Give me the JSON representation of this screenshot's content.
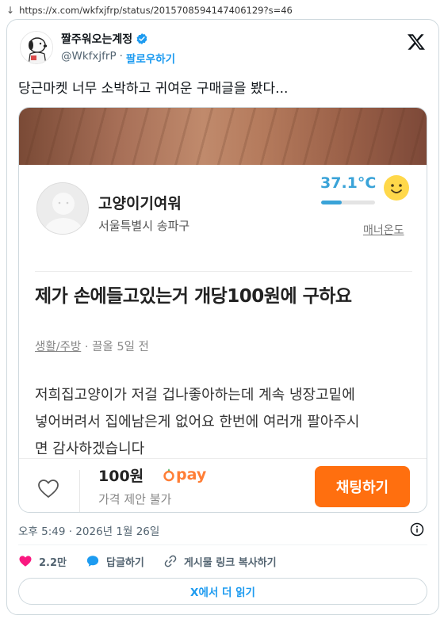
{
  "browser": {
    "url": "https://x.com/wkfxjfrp/status/2015708594147406129?s=46"
  },
  "tweet": {
    "display_name": "짤주워오는계정",
    "handle": "@WkfxjfrP",
    "follow_label": "팔로우하기",
    "text": "당근마켓 너무 소박하고 귀여운 구매글을 봤다...",
    "timestamp": "오후 5:49 · 2026년 1월 26일",
    "likes_count": "2.2만",
    "reply_label": "답글하기",
    "copy_link_label": "게시물 링크 복사하기",
    "read_more_label": "X에서 더 읽기",
    "icons": {
      "verified": "verified-badge-icon",
      "logo": "x-logo-icon",
      "like": "heart-icon",
      "reply": "speech-bubble-icon",
      "link": "link-icon",
      "info": "info-icon"
    },
    "colors": {
      "accent": "#1d9bf0",
      "like": "#f91880"
    }
  },
  "listing": {
    "seller_name": "고양이기여워",
    "seller_location": "서울특별시 송파구",
    "manner_temp": "37.1°C",
    "manner_temp_fill_pct": 38,
    "manner_label": "매너온도",
    "title": "제가 손에들고있는거 개당100원에 구하요",
    "category": "생활/주방",
    "posted": " · 끌올 5일 전",
    "body_lines": [
      "저희집고양이가 저걸 겁나좋아하는데 계속 냉장고밑에",
      "넣어버려서 집에남은게 없어요 한번에 여러개 팔아주시",
      "면 감사하겠습니다"
    ],
    "price": "100원",
    "pay_label": "pay",
    "price_note": "가격 제안 불가",
    "chat_button": "채팅하기",
    "colors": {
      "brand": "#ff6f0f",
      "temperature": "#3aa3d8"
    }
  }
}
